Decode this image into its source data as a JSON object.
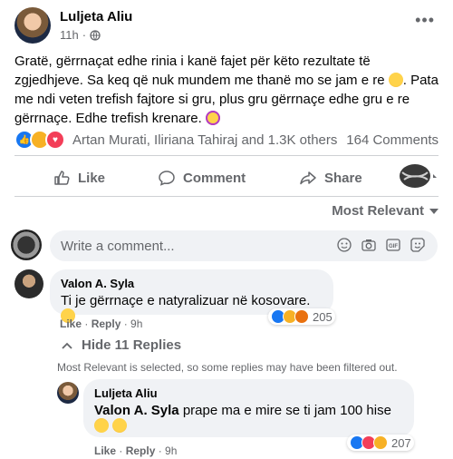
{
  "post": {
    "author": "Luljeta Aliu",
    "time": "11h",
    "visibility_icon": "globe-icon",
    "text_line1": "Gratë, gërrnaçat edhe rinia i kanë fajet për këto rezultate të zgjedhjeve. Sa keq që nuk mundem me thanë mo se jam e re",
    "text_line2": ". Pata me ndi veten trefish fajtore si gru, plus gru gërrnaçe edhe gru e re gërrnaçe. Edhe trefish krenare.",
    "reaction_names": "Artan Murati, Iliriana Tahiraj and 1.3K others",
    "comments_count": "164 Comments"
  },
  "actions": {
    "like": "Like",
    "comment": "Comment",
    "share": "Share"
  },
  "sort": {
    "label": "Most Relevant"
  },
  "composer": {
    "placeholder": "Write a comment..."
  },
  "comments": [
    {
      "author": "Valon A. Syla",
      "text": "Ti je gërrnaçe e natyralizuar në kosovare.",
      "like": "Like",
      "reply": "Reply",
      "time": "9h",
      "reaction_count": "205"
    }
  ],
  "replies_toggle": "Hide 11 Replies",
  "filter_note": "Most Relevant is selected, so some replies may have been filtered out.",
  "reply": {
    "author": "Luljeta Aliu",
    "mention": "Valon A. Syla",
    "text": "prape ma e mire se ti jam 100 hise",
    "like": "Like",
    "reply": "Reply",
    "time": "9h",
    "reaction_count": "207"
  },
  "colors": {
    "facebook_blue": "#1877f2",
    "secondary_text": "#65676b",
    "bubble_bg": "#f0f2f5"
  }
}
